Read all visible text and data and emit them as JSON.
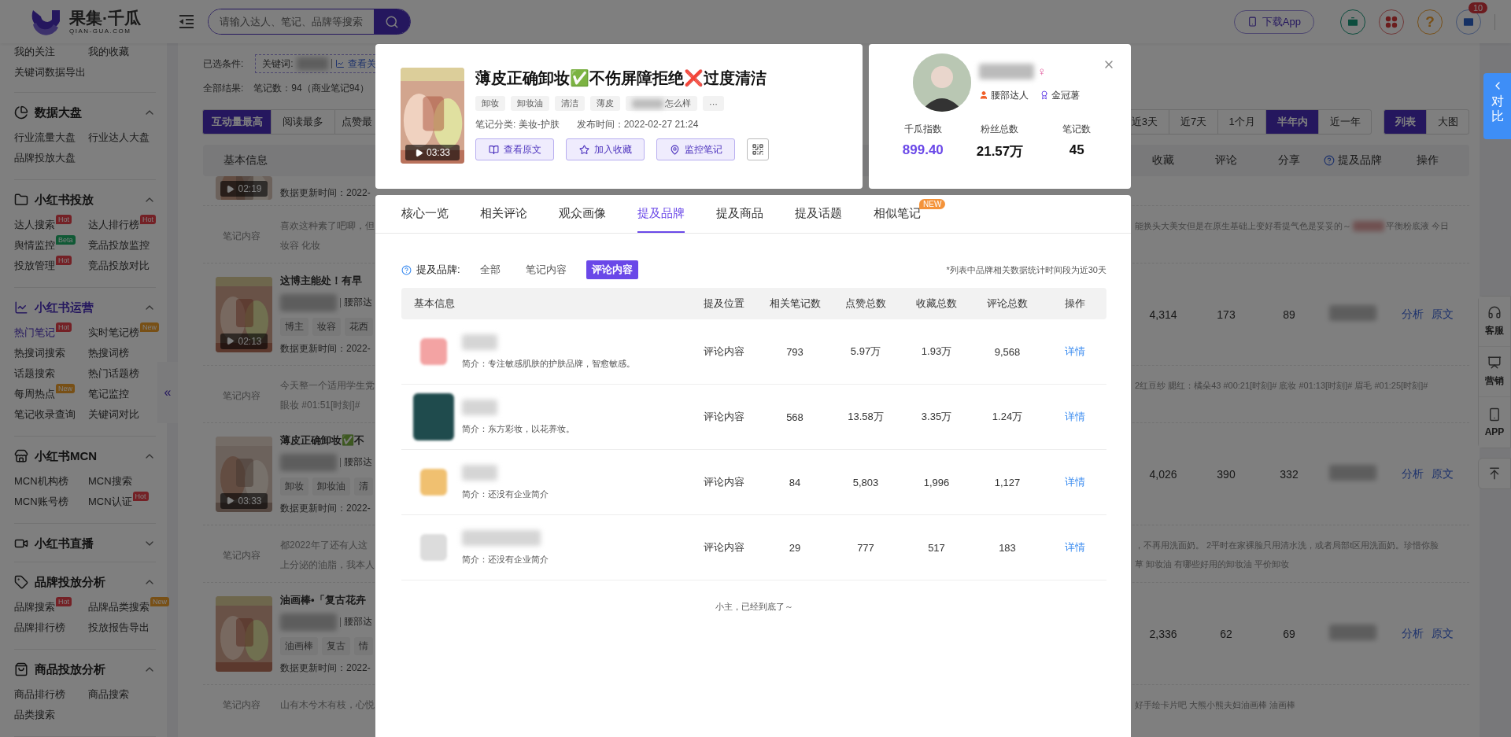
{
  "header": {
    "logo": {
      "name": "果集·千瓜",
      "domain": "QIAN-GUA.COM"
    },
    "search": {
      "placeholder": "请输入达人、笔记、品牌等搜索"
    },
    "download_button": "下载App",
    "help_label": "?",
    "mail_badge": "10"
  },
  "sidebar": {
    "top_items": [
      {
        "label": "我的关注"
      },
      {
        "label": "我的收藏"
      },
      {
        "label": "关键词数据导出"
      }
    ],
    "sections": [
      {
        "title": "数据大盘",
        "expanded": true,
        "active": false,
        "items": [
          {
            "label": "行业流量大盘",
            "selected": false
          },
          {
            "label": "行业达人大盘",
            "selected": false
          },
          {
            "label": "品牌投放大盘",
            "selected": false
          }
        ]
      },
      {
        "title": "小红书投放",
        "expanded": true,
        "active": false,
        "items": [
          {
            "label": "达人搜索",
            "selected": false,
            "badge": {
              "kind": "hot",
              "text": "Hot"
            }
          },
          {
            "label": "达人排行榜",
            "selected": false,
            "badge": {
              "kind": "hot",
              "text": "Hot"
            }
          },
          {
            "label": "舆情监控",
            "selected": false,
            "badge": {
              "kind": "beta",
              "text": "Beta"
            }
          },
          {
            "label": "竞品投放监控",
            "selected": false
          },
          {
            "label": "投放管理",
            "selected": false,
            "badge": {
              "kind": "hot",
              "text": "Hot"
            }
          },
          {
            "label": "竞品投放对比",
            "selected": false
          }
        ]
      },
      {
        "title": "小红书运营",
        "expanded": true,
        "active": true,
        "items": [
          {
            "label": "热门笔记",
            "selected": true,
            "badge": {
              "kind": "hot",
              "text": "Hot"
            }
          },
          {
            "label": "实时笔记榜",
            "selected": false,
            "badge": {
              "kind": "new",
              "text": "New"
            }
          },
          {
            "label": "热搜词搜索",
            "selected": false
          },
          {
            "label": "热搜词榜",
            "selected": false
          },
          {
            "label": "话题搜索",
            "selected": false
          },
          {
            "label": "热门话题榜",
            "selected": false
          },
          {
            "label": "每周热点",
            "selected": false,
            "badge": {
              "kind": "new",
              "text": "New"
            }
          },
          {
            "label": "笔记监控",
            "selected": false
          },
          {
            "label": "笔记收录查询",
            "selected": false
          },
          {
            "label": "关键词对比",
            "selected": false
          }
        ]
      },
      {
        "title": "小红书MCN",
        "expanded": true,
        "active": false,
        "items": [
          {
            "label": "MCN机构榜",
            "selected": false
          },
          {
            "label": "MCN搜索",
            "selected": false
          },
          {
            "label": "MCN账号榜",
            "selected": false
          },
          {
            "label": "MCN认证",
            "selected": false,
            "badge": {
              "kind": "hot",
              "text": "Hot"
            }
          }
        ]
      },
      {
        "title": "小红书直播",
        "expanded": false,
        "active": false
      },
      {
        "title": "品牌投放分析",
        "expanded": true,
        "active": false,
        "items": [
          {
            "label": "品牌搜索",
            "selected": false,
            "badge": {
              "kind": "hot",
              "text": "Hot"
            }
          },
          {
            "label": "品牌品类搜索",
            "selected": false,
            "badge": {
              "kind": "new",
              "text": "New"
            }
          },
          {
            "label": "品牌排行榜",
            "selected": false
          },
          {
            "label": "投放报告导出",
            "selected": false
          }
        ]
      },
      {
        "title": "商品投放分析",
        "expanded": true,
        "active": false,
        "items": [
          {
            "label": "商品排行榜",
            "selected": false
          },
          {
            "label": "商品搜索",
            "selected": false
          },
          {
            "label": "品类搜索",
            "selected": false
          }
        ]
      }
    ],
    "collapse_label": "«"
  },
  "main": {
    "conditions": {
      "label": "已选条件:",
      "keyword_label": "关键词:",
      "link": "查看关"
    },
    "results": {
      "label": "全部结果:",
      "value": "笔记数：94（商业笔记94）"
    },
    "sort_tabs": [
      {
        "label": "互动量最高",
        "selected": true
      },
      {
        "label": "阅读最多",
        "selected": false
      },
      {
        "label": "点赞最",
        "selected": false
      }
    ],
    "time_tabs": [
      {
        "label": "近3天",
        "selected": false
      },
      {
        "label": "近7天",
        "selected": false
      },
      {
        "label": "1个月",
        "selected": false
      },
      {
        "label": "半年内",
        "selected": true
      },
      {
        "label": "近一年",
        "selected": false
      }
    ],
    "view_tabs": [
      {
        "label": "列表",
        "selected": true
      },
      {
        "label": "大图",
        "selected": false
      }
    ],
    "columns": {
      "left": "基本信息",
      "right": [
        "收藏",
        "评论",
        "分享",
        "提及品牌",
        "操作"
      ]
    },
    "rows": [
      {
        "kind": "partial",
        "duration": "02:19",
        "update": "数据更新时间：2022-"
      },
      {
        "kind": "content",
        "label": "笔记内容",
        "left_lines": [
          "喜欢这种素了吧唧，但",
          "妆容 化妆"
        ],
        "right_lines": [
          [
            "能换头大美女但是在原生基础上变好看提气色是妥妥的～",
            "平衡粉底液 今日"
          ]
        ]
      },
      {
        "kind": "note",
        "duration": "02:13",
        "title": "这博主能处！有早",
        "author_tag": "腰部达",
        "tags": [
          "博主",
          "妆容",
          "花西"
        ],
        "update": "数据更新时间：2022-",
        "stats": [
          "4,314",
          "173",
          "89"
        ],
        "actions": [
          "分析",
          "原文"
        ]
      },
      {
        "kind": "content",
        "label": "笔记内容",
        "left_lines": [
          "今天整一个适用学生党",
          "眼妆 #01:51[时刻]#"
        ],
        "right_lines": [
          [
            "2红豆纱 腮红：橘朵43 #00:21[时刻]# 底妆 #01:13[时刻]# 眉毛 #01:25[时刻]#"
          ]
        ]
      },
      {
        "kind": "note",
        "duration": "03:33",
        "title": "薄皮正确卸妆✅不",
        "author_tag": "腰部达",
        "tags": [
          "卸妆",
          "卸妆油",
          "清"
        ],
        "update": "数据更新时间：2022-",
        "stats": [
          "4,026",
          "390",
          "332"
        ],
        "actions": [
          "分析",
          "原文"
        ]
      },
      {
        "kind": "content",
        "label": "笔记内容",
        "left_lines": [
          "都2022年了还有人这",
          "上分泌的油脂，我本人"
        ],
        "right_lines": [
          [
            "，不再用洗面奶。 2平时在家裸脸只用清水洗，或者局部t区用洗面奶。珍惜你脸"
          ],
          [
            "草 卸妆油 有哪些好用的卸妆油 平价卸妆"
          ]
        ]
      },
      {
        "kind": "note",
        "title": "油画棒•「复古花卉",
        "author_tag": "腰部达",
        "tags": [
          "油画棒",
          "复古",
          "情"
        ],
        "update": "数据更新时间：2022-",
        "stats": [
          "2,336",
          "62",
          "69"
        ],
        "actions": [
          "分析",
          "原文"
        ]
      },
      {
        "kind": "content",
        "label": "笔记内容",
        "left_lines": [
          "山有木兮木有枝，心悦"
        ],
        "right_lines": [
          [
            "好手绘卡片吧 大熊小熊夫妇油画棒 油画棒"
          ]
        ]
      }
    ]
  },
  "side_tools": {
    "compare": "对比",
    "tools": [
      "客服",
      "营销",
      "APP"
    ]
  },
  "modal": {
    "note": {
      "duration": "03:33",
      "title": "薄皮正确卸妆✅不伤屏障拒绝❌过度清洁",
      "tags": [
        {
          "text": "卸妆",
          "blurred_prefix": false
        },
        {
          "text": "卸妆油",
          "blurred_prefix": false
        },
        {
          "text": "清洁",
          "blurred_prefix": false
        },
        {
          "text": "薄皮",
          "blurred_prefix": false
        },
        {
          "text": "怎么样",
          "blurred_prefix": true
        },
        {
          "text": "···",
          "blurred_prefix": false
        }
      ],
      "category": "笔记分类: 美妆-护肤",
      "published": "发布时间：2022-02-27 21:24",
      "buttons": [
        "查看原文",
        "加入收藏",
        "监控笔记"
      ]
    },
    "author": {
      "gender": "♀",
      "level": "腰部达人",
      "badge": "金冠薯",
      "stats": [
        {
          "label": "千瓜指数",
          "value": "899.40"
        },
        {
          "label": "粉丝总数",
          "value": "21.57万"
        },
        {
          "label": "笔记数",
          "value": "45"
        }
      ]
    },
    "tabs": [
      {
        "label": "核心一览",
        "selected": false
      },
      {
        "label": "相关评论",
        "selected": false
      },
      {
        "label": "观众画像",
        "selected": false
      },
      {
        "label": "提及品牌",
        "selected": true
      },
      {
        "label": "提及商品",
        "selected": false
      },
      {
        "label": "提及话题",
        "selected": false
      },
      {
        "label": "相似笔记",
        "selected": false,
        "badge": "NEW"
      }
    ],
    "filter": {
      "label": "提及品牌:",
      "options": [
        {
          "label": "全部",
          "selected": false
        },
        {
          "label": "笔记内容",
          "selected": false
        },
        {
          "label": "评论内容",
          "selected": true
        }
      ],
      "note": "*列表中品牌相关数据统计时间段为近30天"
    },
    "table": {
      "columns": [
        "基本信息",
        "提及位置",
        "相关笔记数",
        "点赞总数",
        "收藏总数",
        "评论总数",
        "操作"
      ],
      "rows": [
        {
          "color": "#f3a3a3",
          "intro": "简介：专注敏感肌肤的护肤品牌，智愈敏感。",
          "position": "评论内容",
          "notes": "793",
          "likes": "5.97万",
          "favorites": "1.93万",
          "comments": "9,568",
          "action": "详情"
        },
        {
          "color": "#1f4b4d",
          "intro": "简介：东方彩妆，以花养妆。",
          "position": "评论内容",
          "notes": "568",
          "likes": "13.58万",
          "favorites": "3.35万",
          "comments": "1.24万",
          "action": "详情"
        },
        {
          "color": "#f0c070",
          "intro": "简介：还没有企业简介",
          "position": "评论内容",
          "notes": "84",
          "likes": "5,803",
          "favorites": "1,996",
          "comments": "1,127",
          "action": "详情"
        },
        {
          "color": "#dcdcdc",
          "intro": "简介：还没有企业简介",
          "position": "评论内容",
          "notes": "29",
          "likes": "777",
          "favorites": "517",
          "comments": "183",
          "action": "详情"
        }
      ]
    },
    "footer": "小主，已经到底了～"
  }
}
